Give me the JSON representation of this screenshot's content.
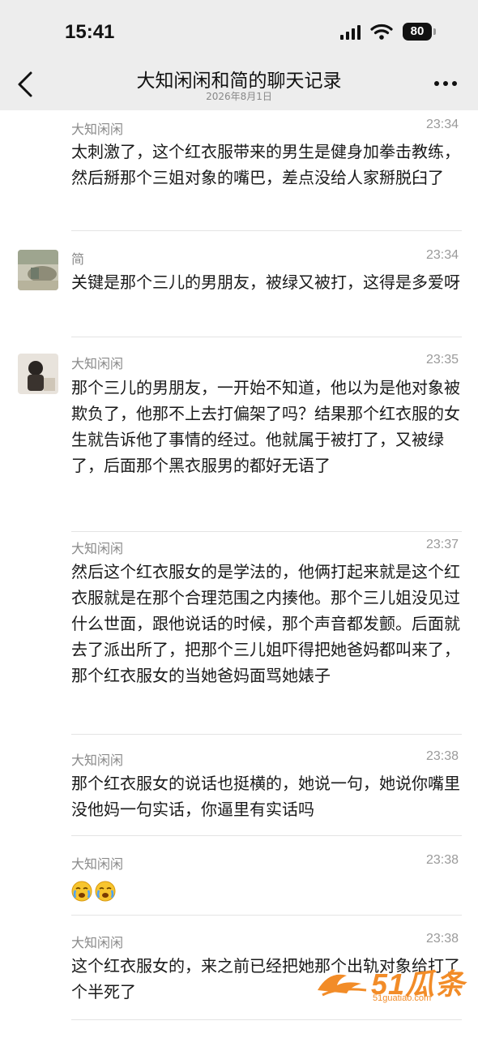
{
  "status": {
    "time": "15:41",
    "battery": "80"
  },
  "nav": {
    "title": "大知闲闲和简的聊天记录",
    "subtitle": "2026年8月1日"
  },
  "messages": [
    {
      "sender": "大知闲闲",
      "time": "23:34",
      "text": "太刺激了，这个红衣服带来的男生是健身加拳击教练，然后掰那个三姐对象的嘴巴，差点没给人家掰脱臼了"
    },
    {
      "sender": "简",
      "time": "23:34",
      "text": "关键是那个三儿的男朋友，被绿又被打，这得是多爱呀"
    },
    {
      "sender": "大知闲闲",
      "time": "23:35",
      "text": "那个三儿的男朋友，一开始不知道，他以为是他对象被欺负了，他那不上去打偏架了吗？结果那个红衣服的女生就告诉他了事情的经过。他就属于被打了，又被绿了，后面那个黑衣服男的都好无语了"
    },
    {
      "sender": "大知闲闲",
      "time": "23:37",
      "text": "然后这个红衣服女的是学法的，他俩打起来就是这个红衣服就是在那个合理范围之内揍他。那个三儿姐没见过什么世面，跟他说话的时候，那个声音都发颤。后面就去了派出所了，把那个三儿姐吓得把她爸妈都叫来了，那个红衣服女的当她爸妈面骂她婊子"
    },
    {
      "sender": "大知闲闲",
      "time": "23:38",
      "text": "那个红衣服女的说话也挺横的，她说一句，她说你嘴里没他妈一句实话，你逼里有实话吗"
    },
    {
      "sender": "大知闲闲",
      "time": "23:38",
      "emojis": [
        "crying-face-icon",
        "crying-face-icon"
      ]
    },
    {
      "sender": "大知闲闲",
      "time": "23:38",
      "text": "这个红衣服女的，来之前已经把她那个出轨对象给打了个半死了"
    }
  ],
  "watermark": {
    "brand": "51瓜条",
    "url": "51guatiao.com",
    "color": "#f28c28"
  }
}
